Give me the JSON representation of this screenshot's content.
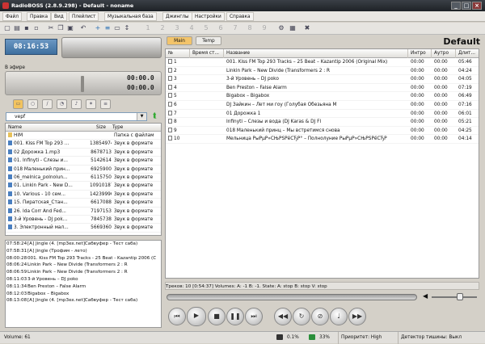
{
  "window": {
    "title": "RadioBOSS (2.8.9.298) - Default - noname",
    "minimize": "_",
    "maximize": "□",
    "close": "×"
  },
  "menu": [
    "Файл",
    "Правка",
    "Вид",
    "Плейлист",
    "Музыкальная база",
    "Джинглы",
    "Настройки",
    "Справка"
  ],
  "clock": "08:16:53",
  "on_air_label": "В эфире",
  "player": {
    "time_elapsed": "00:00.0",
    "time_remaining": "00:00.0"
  },
  "browser": {
    "folder": "vepf",
    "columns": [
      "Name",
      "Size",
      "Type"
    ],
    "files": [
      {
        "name": "НІМ",
        "size": "",
        "type": "Папка с файлам"
      },
      {
        "name": "001. Kiss FM Top 293 ...",
        "size": "13854974",
        "type": "Звук в формате"
      },
      {
        "name": "02 Дорожка 1.mp3",
        "size": "8678713",
        "type": "Звук в формате"
      },
      {
        "name": "01. Infinyti - Слезы и...",
        "size": "5142614",
        "type": "Звук в формате"
      },
      {
        "name": "018 Маленький прин...",
        "size": "6925900",
        "type": "Звук в формате"
      },
      {
        "name": "06_melnica_polnolun...",
        "size": "6115750",
        "type": "Звук в формате"
      },
      {
        "name": "01. Linkin Park - New D...",
        "size": "10910187",
        "type": "Звук в формате"
      },
      {
        "name": "10. Various - 10 сем...",
        "size": "14239996",
        "type": "Звук в формате"
      },
      {
        "name": "15. Пиратская_Стан...",
        "size": "6617088",
        "type": "Звук в формате"
      },
      {
        "name": "26. Ida Corr And Fed...",
        "size": "7197153",
        "type": "Звук в формате"
      },
      {
        "name": "3-й Уровень - DJ pok...",
        "size": "7845738",
        "type": "Звук в формате"
      },
      {
        "name": "3. Электронный мал...",
        "size": "5669360",
        "type": "Звук в формате"
      }
    ]
  },
  "log": [
    {
      "t": "07:58:24",
      "text": "[A] Jingle (4. [mp3ex.net]Сабвуфер - Тест саба)"
    },
    {
      "t": "07:58:31",
      "text": "[A] Jingle (Трофим - лето)"
    },
    {
      "t": "08:00:28",
      "text": "001. Kiss FM Top 293 Tracks - 25 Beat - Kazantip 2006 (C"
    },
    {
      "t": "08:06:24",
      "text": "Linkin Park – New Divide (Transformers 2 : R"
    },
    {
      "t": "08:06:59",
      "text": "Linkin Park – New Divide (Transformers 2 : R"
    },
    {
      "t": "08:11:03",
      "text": "3-й Уровень – DJ poko"
    },
    {
      "t": "08:11:34",
      "text": "Ben Preston – False Alarm"
    },
    {
      "t": "08:12:03",
      "text": "Bigabox – Bigabox"
    },
    {
      "t": "08:13:08",
      "text": "[A] Jingle (4. [mp3ex.net]Сабвуфер - Тест саба)"
    }
  ],
  "playlist_tabs": [
    "Main",
    "Temp"
  ],
  "playlist_name": "Default",
  "playlist": {
    "columns": [
      "№",
      "Время ст...",
      "Название",
      "Интро",
      "Аутро",
      "Длит..."
    ],
    "rows": [
      {
        "n": "1",
        "title": "001. Kiss FM Top 293 Tracks – 25 Beat – Kazantip 2006 (Original Mix)",
        "intro": "00:00",
        "outro": "00:00",
        "dur": "05:46"
      },
      {
        "n": "2",
        "title": "Linkin Park – New Divide (Transformers 2 : R",
        "intro": "00:00",
        "outro": "00:00",
        "dur": "04:24"
      },
      {
        "n": "3",
        "title": "3-й Уровень – DJ poko",
        "intro": "00:00",
        "outro": "00:00",
        "dur": "04:05"
      },
      {
        "n": "4",
        "title": "Ben Preston – False Alarm",
        "intro": "00:00",
        "outro": "00:00",
        "dur": "07:19"
      },
      {
        "n": "5",
        "title": "Bigabox – Bigabox",
        "intro": "00:00",
        "outro": "00:00",
        "dur": "06:49"
      },
      {
        "n": "6",
        "title": "DJ Зайкин – Лет ми гоу (Голубая Обезьяна M",
        "intro": "00:00",
        "outro": "00:00",
        "dur": "07:16"
      },
      {
        "n": "7",
        "title": "01 Дорожка 1",
        "intro": "00:00",
        "outro": "00:00",
        "dur": "06:01"
      },
      {
        "n": "8",
        "title": "Infinyti – Слезы и вода (DJ Karas & DJ Fl",
        "intro": "00:00",
        "outro": "00:00",
        "dur": "05:21"
      },
      {
        "n": "9",
        "title": "018 Маленький принц – Мы встретимся снова",
        "intro": "00:00",
        "outro": "00:00",
        "dur": "04:25"
      },
      {
        "n": "10",
        "title": "Мельница РыРµР»СЊРЅРёСЂР° – Полнолуние РыРµР»СЊРЅРёСЂР",
        "intro": "00:00",
        "outro": "00:00",
        "dur": "04:14"
      }
    ]
  },
  "status_line": "Треков: 10 [0:54:37]        Volumes: A: -1 B: -1. State: A: stop B: stop V: stop",
  "statusbar": {
    "volume": "Volume: 61",
    "cpu": "0.1%",
    "mem": "33%",
    "priority": "Приоритет: High",
    "silence": "Детектор тишины: Выкл"
  },
  "colors": {
    "accent": "#4d7fb0",
    "tab_active": "#f3c46a"
  }
}
